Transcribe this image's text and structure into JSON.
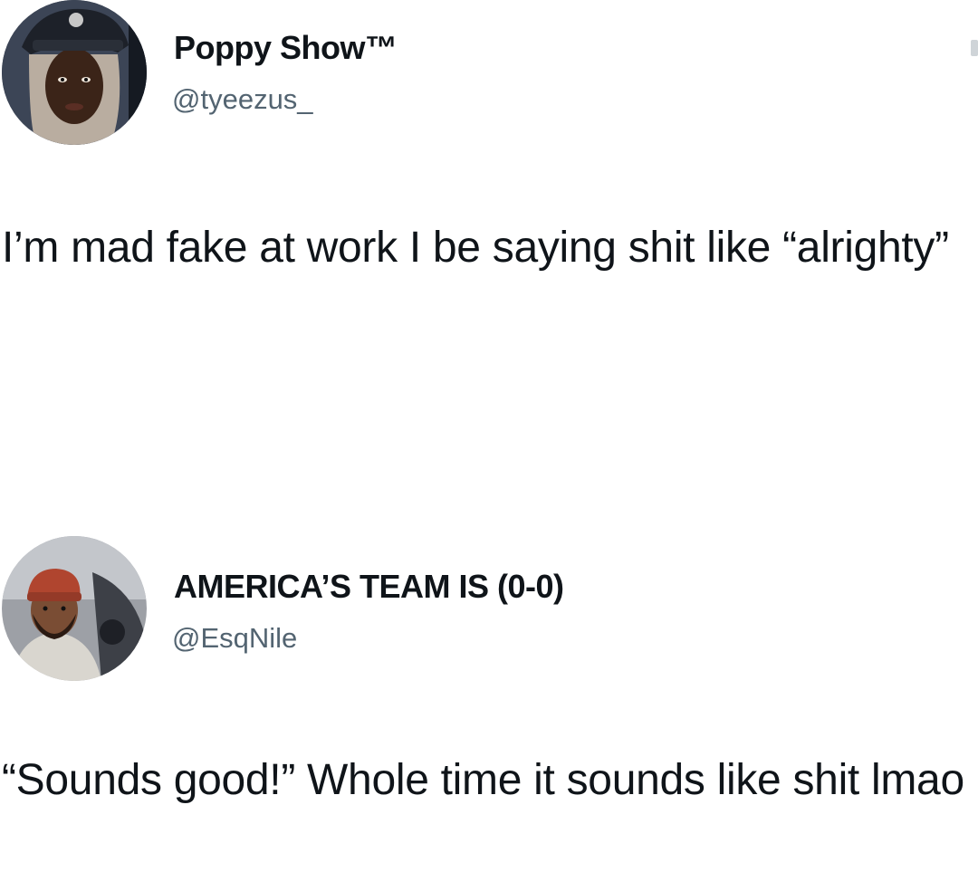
{
  "tweets": [
    {
      "avatar_icon": "profile-photo-icon",
      "display_name": "Poppy Show™",
      "handle": "@tyeezus_",
      "text": "I’m mad fake at work I be saying shit like “alrighty”"
    },
    {
      "avatar_icon": "profile-photo-icon",
      "display_name": "AMERICA’S TEAM IS (0-0)",
      "handle": "@EsqNile",
      "text": "“Sounds good!” Whole time it sounds like shit lmao"
    }
  ],
  "colors": {
    "text": "#0f1419",
    "handle": "#536471",
    "background": "#ffffff"
  }
}
